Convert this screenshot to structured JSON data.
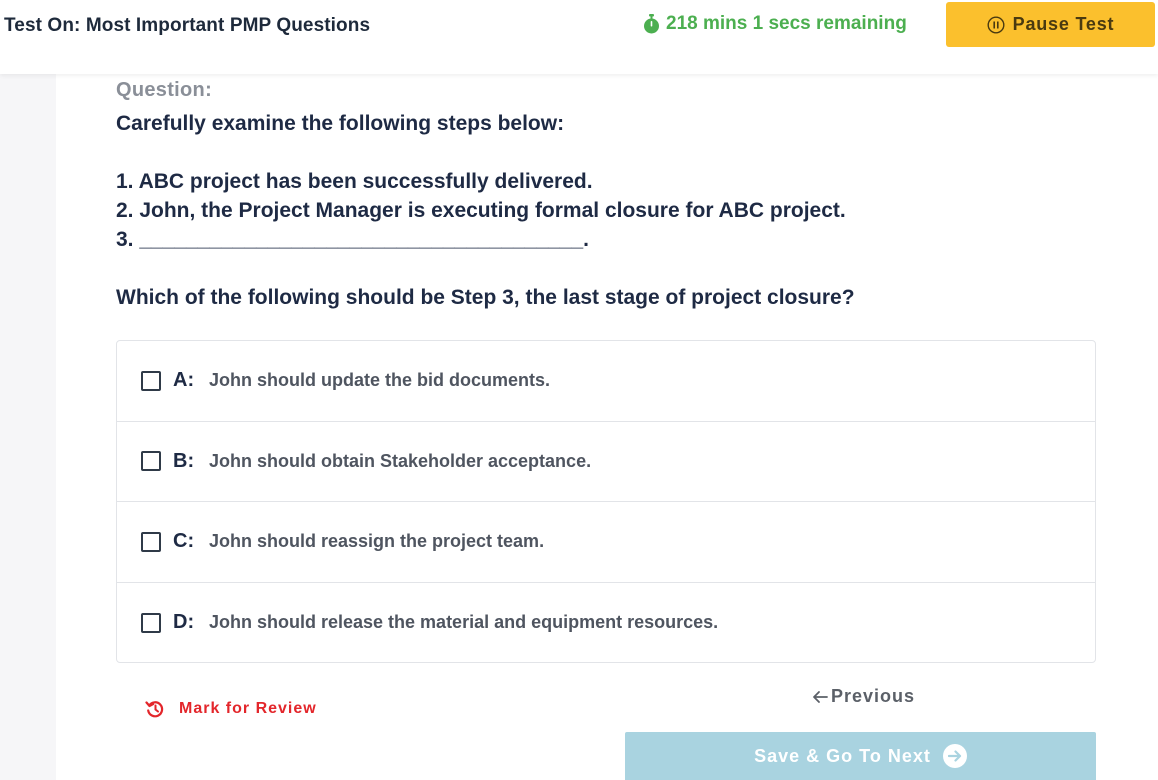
{
  "header": {
    "title": "Test On: Most Important PMP Questions",
    "timer": "218 mins 1 secs remaining",
    "pause_label": "Pause Test",
    "timer_color": "#4caf50",
    "pause_color": "#fbc02d"
  },
  "question": {
    "label": "Question:",
    "intro": "Carefully examine the following steps below:",
    "step1": "1. ABC project has been successfully delivered.",
    "step2": "2. John, the Project Manager is executing formal closure for ABC project.",
    "step3": "3. ______________________________________.",
    "prompt": "Which of the following should be Step 3, the last stage of project closure?"
  },
  "options": [
    {
      "letter": "A:",
      "text": "John should update the bid documents.",
      "checked": false
    },
    {
      "letter": "B:",
      "text": "John should obtain Stakeholder acceptance.",
      "checked": false
    },
    {
      "letter": "C:",
      "text": "John should reassign the project team.",
      "checked": false
    },
    {
      "letter": "D:",
      "text": "John should release the material and equipment resources.",
      "checked": false
    }
  ],
  "footer": {
    "mark_review": "Mark for Review",
    "previous": "Previous",
    "save_next": "Save & Go To Next",
    "mark_color": "#e3262b",
    "save_color": "#a9d3e0"
  },
  "icons": {
    "timer": "stopwatch-icon",
    "pause": "pause-circle-icon",
    "mark": "history-icon",
    "previous": "arrow-left-icon",
    "next": "arrow-right-circle-icon"
  }
}
